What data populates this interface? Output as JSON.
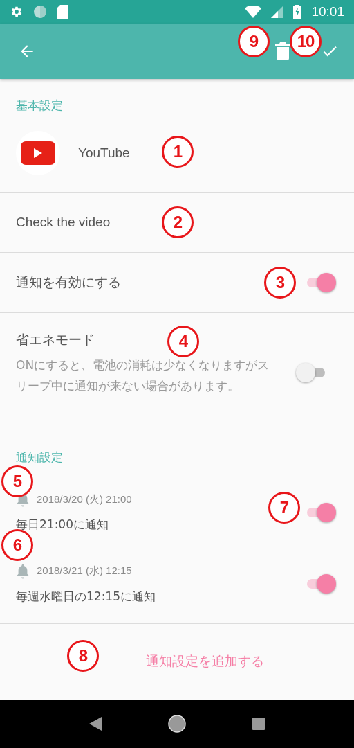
{
  "status_bar": {
    "time": "10:01"
  },
  "sections": [
    {
      "header": "基本設定"
    },
    {
      "header": "通知設定"
    }
  ],
  "app": {
    "name": "YouTube"
  },
  "title_field": {
    "value": "Check the video"
  },
  "notify_setting": {
    "label": "通知を有効にする",
    "on": true
  },
  "eco_mode": {
    "label": "省エネモード",
    "description": "ONにすると、電池の消耗は少なくなりますがスリープ中に通知が来ない場合があります。",
    "on": false
  },
  "reminders": [
    {
      "date": "2018/3/20 (火) 21:00",
      "text": "毎日21:00に通知",
      "on": true
    },
    {
      "date": "2018/3/21 (水) 12:15",
      "text": "毎週水曜日の12:15に通知",
      "on": true
    }
  ],
  "add_button": {
    "label": "通知設定を追加する"
  },
  "annotations": [
    {
      "label": "1"
    },
    {
      "label": "2"
    },
    {
      "label": "3"
    },
    {
      "label": "4"
    },
    {
      "label": "5"
    },
    {
      "label": "6"
    },
    {
      "label": "7"
    },
    {
      "label": "8"
    },
    {
      "label": "9"
    },
    {
      "label": "10"
    }
  ]
}
